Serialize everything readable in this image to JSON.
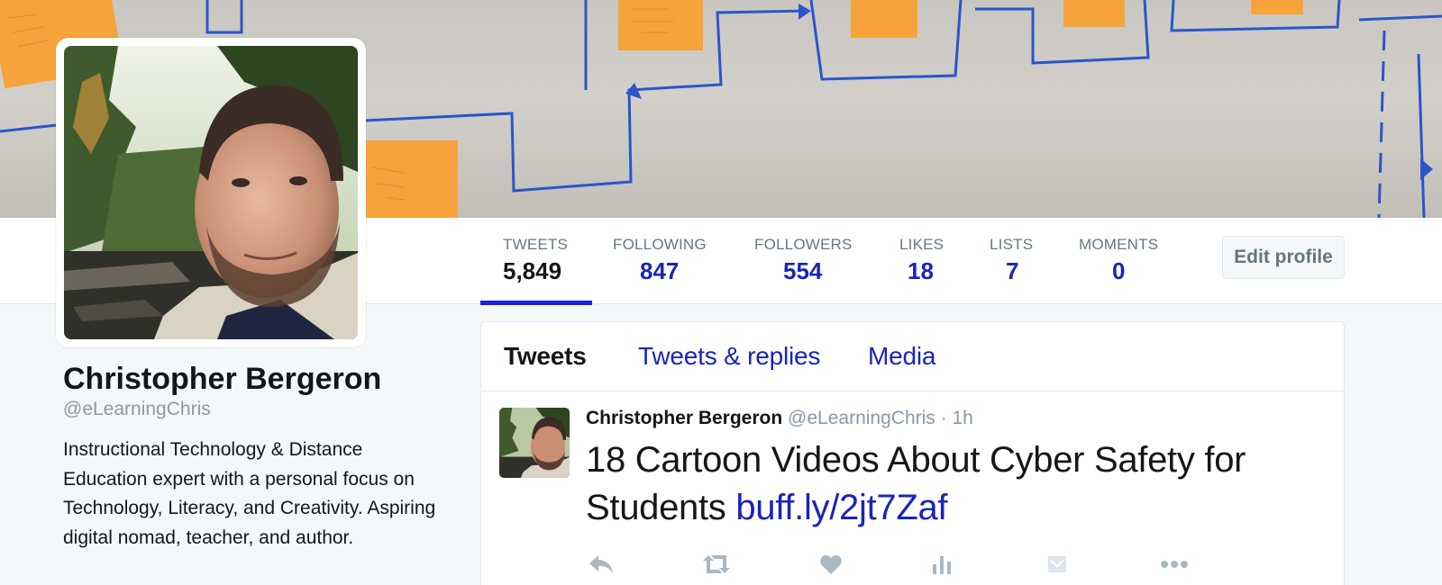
{
  "profile": {
    "name": "Christopher Bergeron",
    "handle": "@eLearningChris",
    "bio": "Instructional Technology & Distance Education expert with a personal focus on Technology, Literacy, and Creativity. Aspiring digital nomad, teacher, and author."
  },
  "stats": [
    {
      "label": "TWEETS",
      "value": "5,849"
    },
    {
      "label": "FOLLOWING",
      "value": "847"
    },
    {
      "label": "FOLLOWERS",
      "value": "554"
    },
    {
      "label": "LIKES",
      "value": "18"
    },
    {
      "label": "LISTS",
      "value": "7"
    },
    {
      "label": "MOMENTS",
      "value": "0"
    }
  ],
  "edit_profile_label": "Edit profile",
  "timeline": {
    "tabs": [
      "Tweets",
      "Tweets & replies",
      "Media"
    ],
    "tweet": {
      "author": "Christopher Bergeron",
      "handle": "@eLearningChris",
      "time": "· 1h",
      "text": "18 Cartoon Videos About Cyber Safety for Students",
      "link": "buff.ly/2jt7Zaf",
      "actions": [
        "reply-icon",
        "retweet-icon",
        "like-icon",
        "analytics-icon",
        "dm-icon",
        "more-icon"
      ]
    }
  },
  "colors": {
    "accent": "#1a24b8",
    "underline": "#1a21e0",
    "muted": "#8899a6",
    "background": "#f5f8fa"
  }
}
